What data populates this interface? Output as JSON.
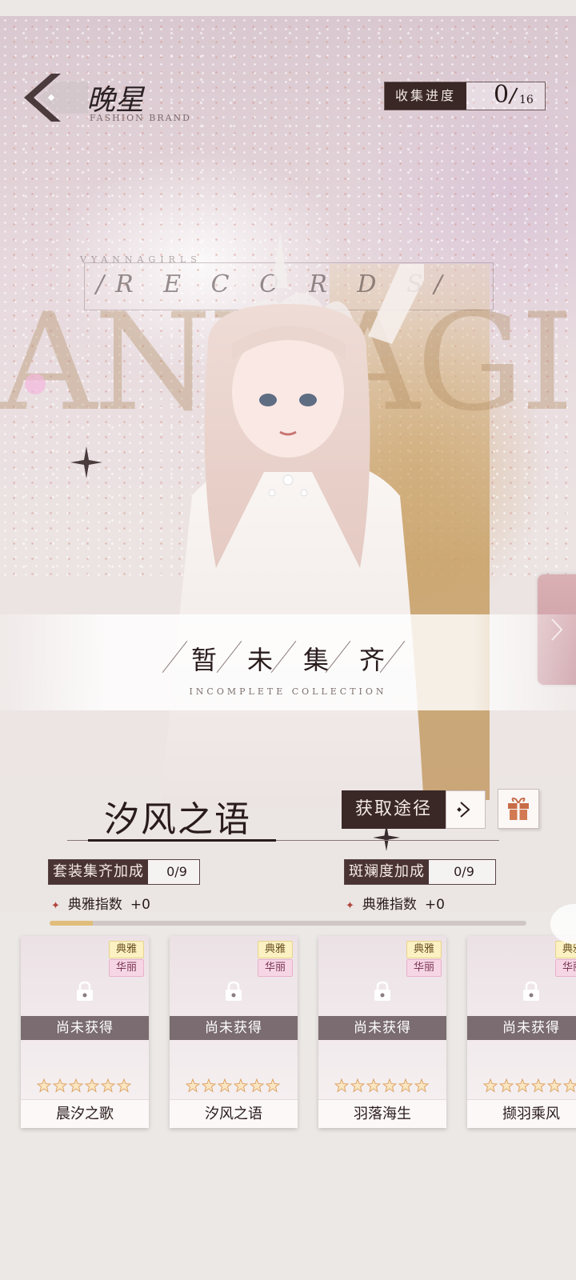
{
  "header": {
    "brand_name": "晚星",
    "brand_subtitle": "FASHION BRAND",
    "progress_label": "收集进度",
    "progress_count": "0",
    "progress_total": "16"
  },
  "backdrop": {
    "record_small": "VYANNAGIRLS",
    "record_text": "/R E C O R D S/",
    "big_letters": "ANNAGIRL"
  },
  "status_banner": {
    "chars": [
      "暂",
      "未",
      "集",
      "齐"
    ],
    "subtitle": "INCOMPLETE     COLLECTION"
  },
  "suit": {
    "name": "汐风之语",
    "obtain_label": "获取途径"
  },
  "bonuses": [
    {
      "label": "套装集齐加成",
      "value": "0/9",
      "stat_name": "典雅指数",
      "stat_value": "+0"
    },
    {
      "label": "斑斓度加成",
      "value": "0/9",
      "stat_name": "典雅指数",
      "stat_value": "+0"
    }
  ],
  "bonus_progress": 0.09,
  "items": [
    {
      "name": "晨汐之歌",
      "status": "尚未获得",
      "tags": [
        "典雅",
        "华丽"
      ],
      "stars": 6
    },
    {
      "name": "汐风之语",
      "status": "尚未获得",
      "tags": [
        "典雅",
        "华丽"
      ],
      "stars": 6
    },
    {
      "name": "羽落海生",
      "status": "尚未获得",
      "tags": [
        "典雅",
        "华丽"
      ],
      "stars": 6
    },
    {
      "name": "撷羽乘风",
      "status": "尚未获得",
      "tags": [
        "典雅",
        "华丽"
      ],
      "stars": 6
    }
  ],
  "colors": {
    "accent_dark": "#3a2827",
    "gold": "#e0bd7a",
    "tag_gold": "#fbf1c2",
    "tag_pink": "#f6d6e5"
  },
  "icons": [
    "brand-logo-icon",
    "chevron-right-icon",
    "gift-icon",
    "lock-icon",
    "star-icon",
    "sparkle-star-icon"
  ]
}
